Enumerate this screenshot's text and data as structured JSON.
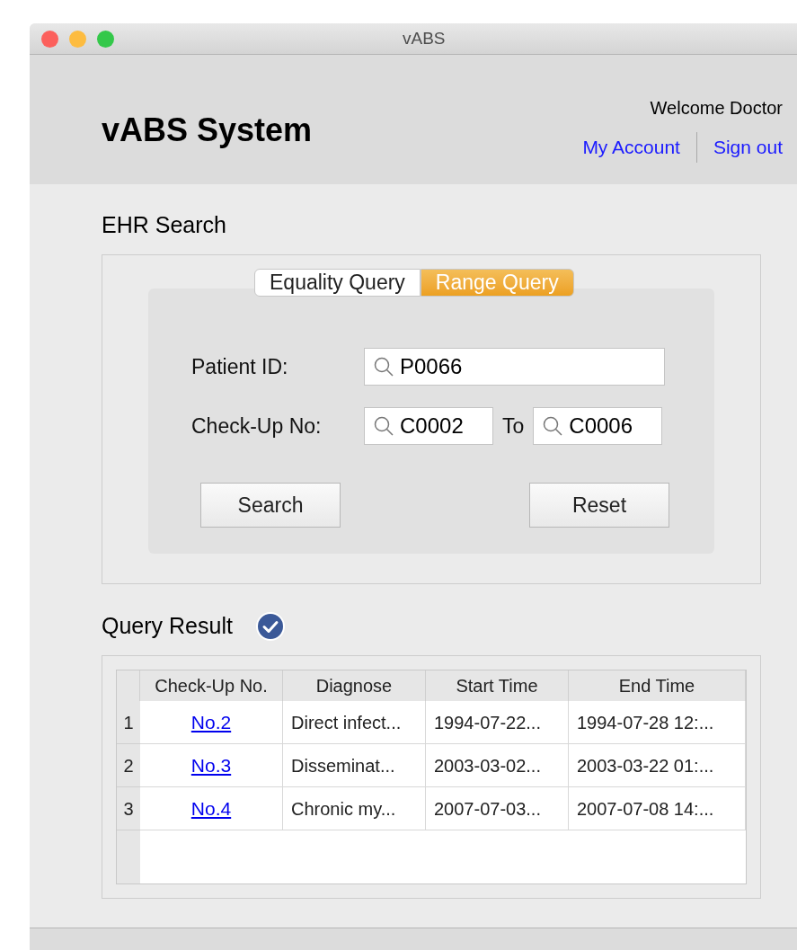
{
  "window": {
    "title": "vABS"
  },
  "header": {
    "title": "vABS System",
    "welcome": "Welcome Doctor",
    "links": [
      "My Account",
      "Sign out"
    ]
  },
  "ehr_search": {
    "heading": "EHR Search",
    "tabs": [
      {
        "label": "Equality Query",
        "selected": false
      },
      {
        "label": "Range Query",
        "selected": true
      }
    ],
    "patient_id": {
      "label": "Patient ID:",
      "value": "P0066"
    },
    "checkup": {
      "label": "Check-Up No:",
      "from": "C0002",
      "separator": "To",
      "to": "C0006"
    },
    "buttons": [
      "Search",
      "Reset"
    ]
  },
  "query_result": {
    "heading": "Query Result",
    "verified": true,
    "table": {
      "columns": [
        "Check-Up No.",
        "Diagnose",
        "Start Time",
        "End Time"
      ],
      "rows": [
        {
          "index": "1",
          "cells": [
            "No.2",
            "Direct infect...",
            "1994-07-22...",
            "1994-07-28 12:..."
          ]
        },
        {
          "index": "2",
          "cells": [
            "No.3",
            "Disseminat...",
            "2003-03-02...",
            "2003-03-22 01:..."
          ]
        },
        {
          "index": "3",
          "cells": [
            "No.4",
            "Chronic my...",
            "2007-07-03...",
            "2007-07-08 14:..."
          ]
        }
      ]
    }
  }
}
